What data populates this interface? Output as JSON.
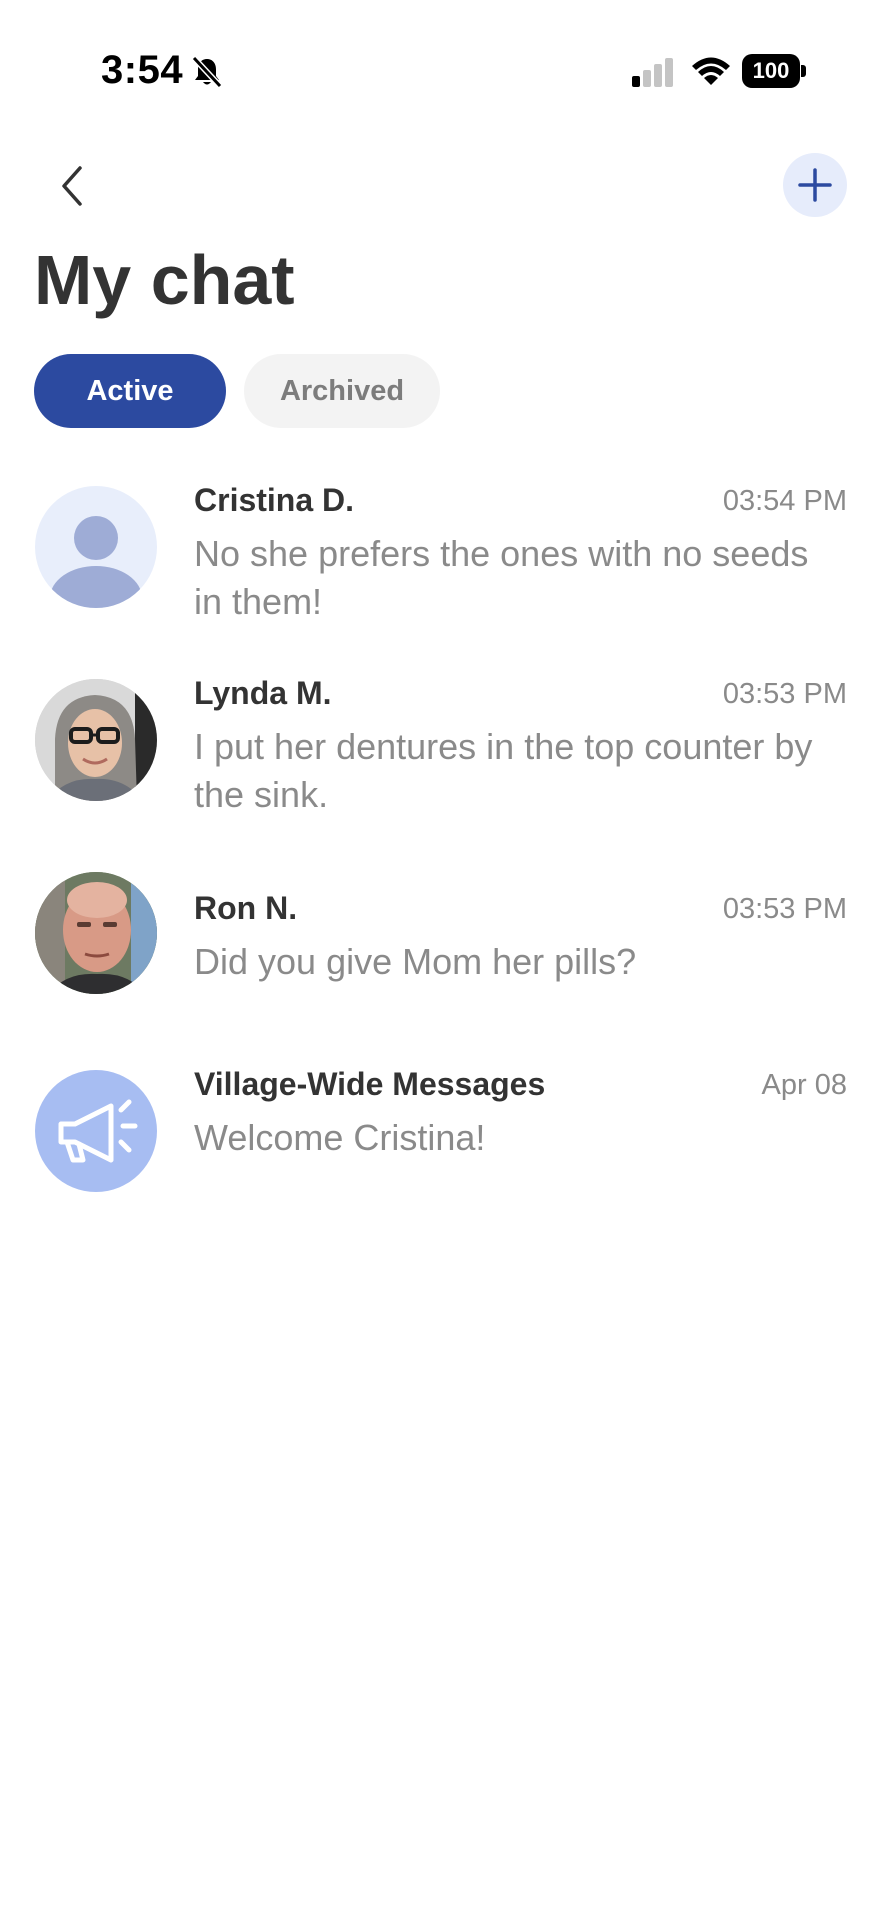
{
  "status_bar": {
    "time": "3:54",
    "battery": "100"
  },
  "header": {
    "title": "My chat"
  },
  "tabs": [
    {
      "label": "Active"
    },
    {
      "label": "Archived"
    }
  ],
  "chats": [
    {
      "name": "Cristina D.",
      "time": "03:54 PM",
      "preview": "No she prefers the ones with no seeds in them!"
    },
    {
      "name": "Lynda M.",
      "time": "03:53 PM",
      "preview": "I put her dentures in the top counter by the sink."
    },
    {
      "name": "Ron N.",
      "time": "03:53 PM",
      "preview": "Did you give Mom her pills?"
    },
    {
      "name": "Village-Wide Messages",
      "time": "Apr 08",
      "preview": "Welcome Cristina!"
    }
  ],
  "colors": {
    "accent": "#2c4aa0",
    "add_button_bg": "#e6ecfb",
    "placeholder_avatar_bg": "#e8eefb",
    "placeholder_avatar_fg": "#9eacd6",
    "announcement_avatar_bg": "#a7bdf2"
  }
}
